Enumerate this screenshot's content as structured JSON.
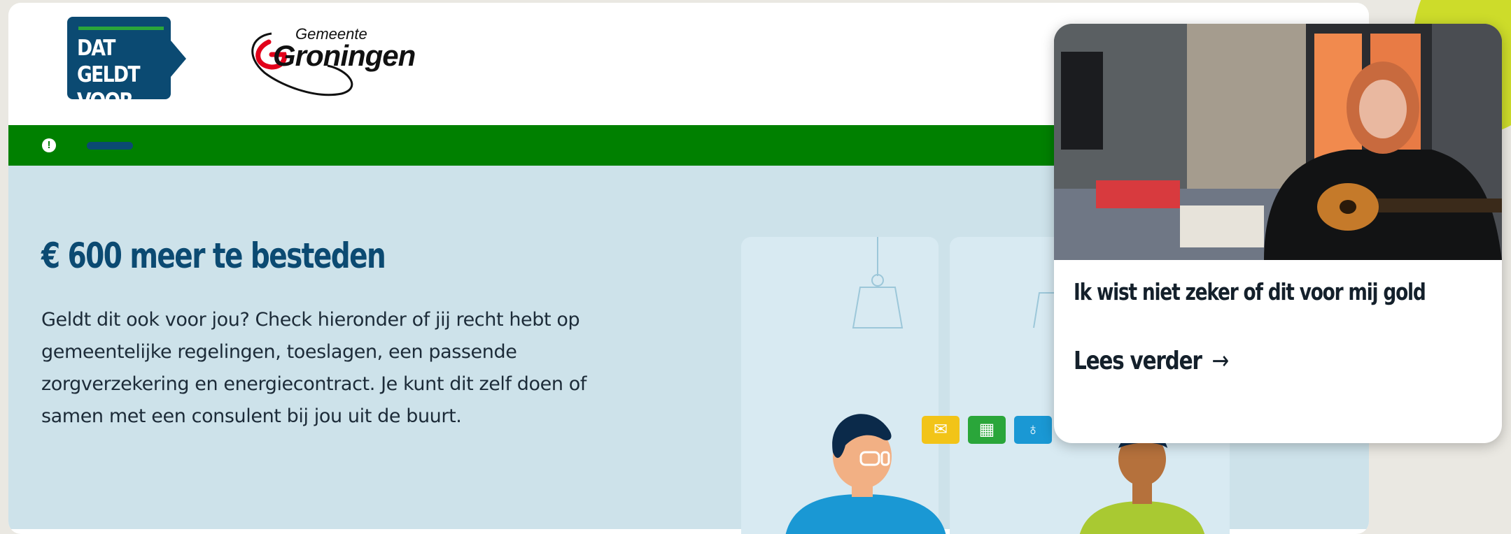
{
  "header": {
    "logo_primary_text": "DAT GELDT\nVOOR MIJ",
    "logo_municipality_small": "Gemeente",
    "logo_municipality_name": "Groningen"
  },
  "notice_bar": {
    "alert_icon": "exclamation-circle-icon",
    "bg_color": "#008000"
  },
  "hero": {
    "title": "€ 600 meer te besteden",
    "intro": "Geldt dit ook voor jou? Check hieronder of jij recht hebt op gemeentelijke regelingen, toeslagen, een passende zorgverzekering en energiecontract. Je kunt dit zelf doen of samen met een consulent bij jou uit de buurt.",
    "category_icons": [
      "mail-icon",
      "building-icon",
      "lightbulb-icon"
    ]
  },
  "story_card": {
    "heading": "Ik wist niet zeker of dit voor mij gold",
    "link_label": "Lees verder",
    "link_arrow": "→"
  },
  "colors": {
    "brand_blue": "#0b4a72",
    "brand_green": "#008000",
    "hero_bg": "#cde2ea",
    "accent_lime": "#cddc2a"
  }
}
